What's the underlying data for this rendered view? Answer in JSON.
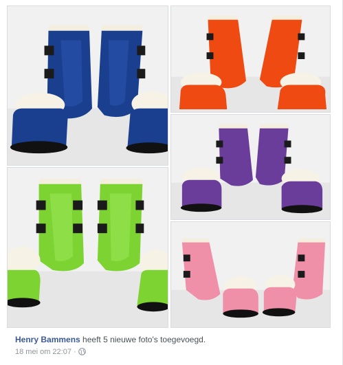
{
  "post": {
    "author": "Henry Bammens",
    "action_text": " heeft 5 nieuwe foto's toegevoegd.",
    "timestamp": "18 mei om 22:07",
    "separator": "·",
    "privacy_icon": "globe-icon"
  },
  "photos": [
    {
      "name": "blue",
      "color": "#1a3f8f",
      "shade": "#0f2a66"
    },
    {
      "name": "orange",
      "color": "#ef4a12",
      "shade": "#c2360a"
    },
    {
      "name": "purple",
      "color": "#6b3d9a",
      "shade": "#4e2a75"
    },
    {
      "name": "green",
      "color": "#7dd332",
      "shade": "#5aa61e"
    },
    {
      "name": "pink",
      "color": "#ef8fa8",
      "shade": "#d46d89"
    }
  ]
}
